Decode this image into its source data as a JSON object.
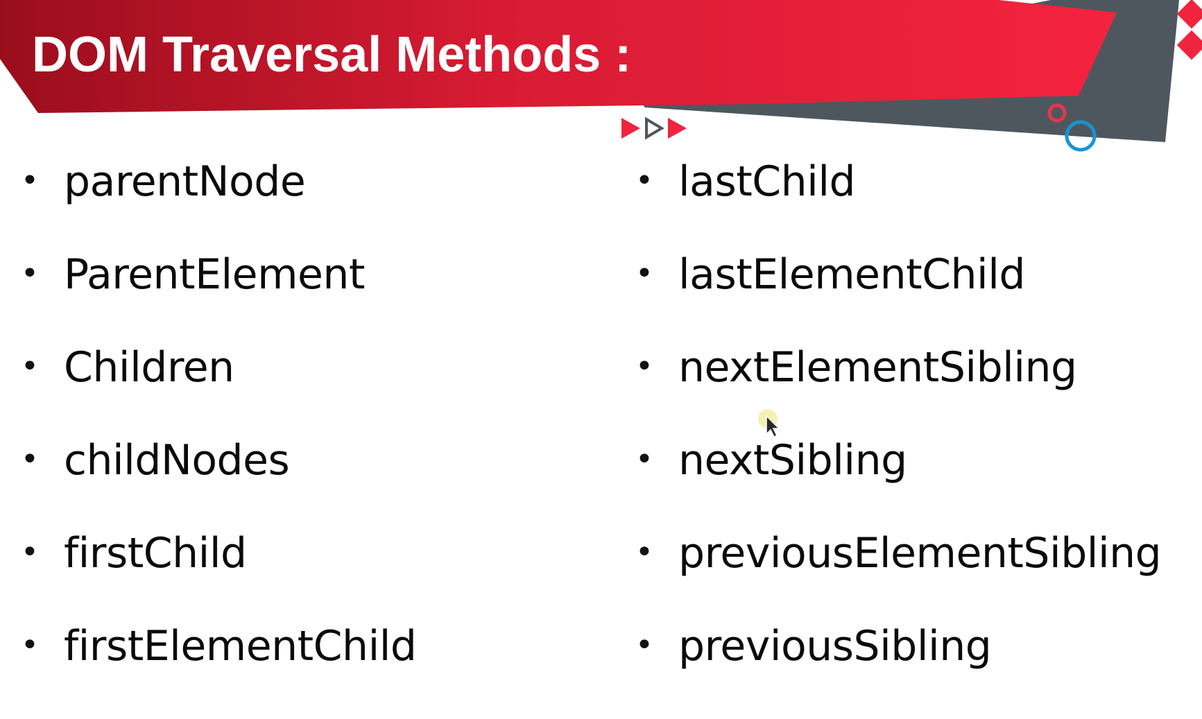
{
  "slide": {
    "title": "DOM Traversal Methods :"
  },
  "columns": {
    "left": [
      {
        "label": "parentNode"
      },
      {
        "label": "ParentElement"
      },
      {
        "label": "Children"
      },
      {
        "label": "childNodes"
      },
      {
        "label": "firstChild"
      },
      {
        "label": "firstElementChild"
      }
    ],
    "right": [
      {
        "label": "lastChild"
      },
      {
        "label": "lastElementChild"
      },
      {
        "label": "nextElementSibling"
      },
      {
        "label": "nextSibling"
      },
      {
        "label": "previousElementSibling"
      },
      {
        "label": "previousSibling"
      }
    ]
  },
  "bullet_char": "•",
  "colors": {
    "banner_red": "#ee2140",
    "banner_dark_red": "#a6111f",
    "banner_gray": "#4f575e",
    "ring_red": "#e8344c",
    "ring_blue": "#1893d6",
    "text": "#0a0a0a"
  },
  "icons": {
    "play_arrows": "triple-play-arrows-icon",
    "diamonds": "red-diamond-icon",
    "rings": "ring-circle-icon",
    "cursor": "mouse-pointer-icon"
  }
}
